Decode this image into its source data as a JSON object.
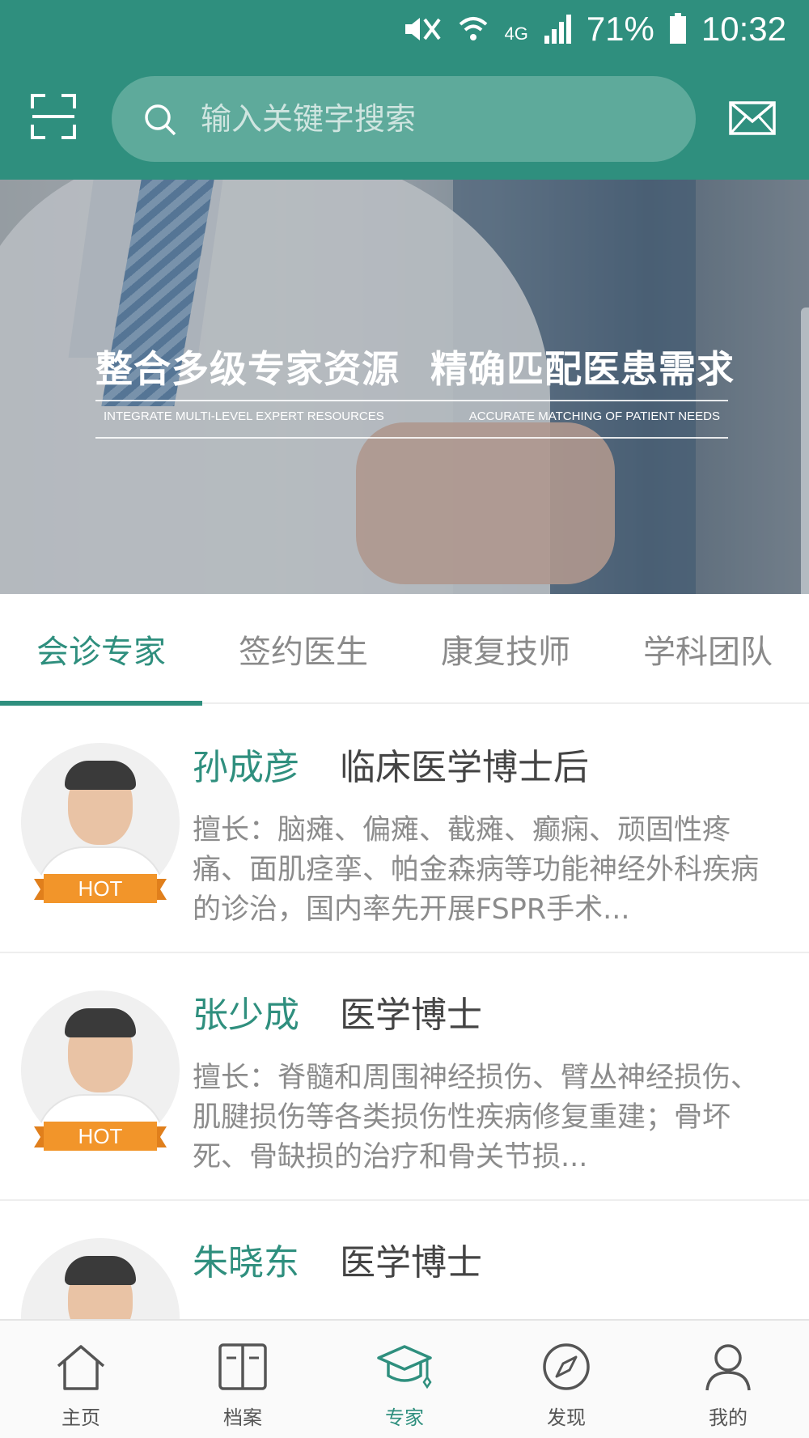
{
  "status_bar": {
    "network": "4G",
    "battery": "71%",
    "time": "10:32"
  },
  "search": {
    "placeholder": "输入关键字搜索"
  },
  "banner": {
    "title_left": "整合多级专家资源",
    "title_right": "精确匹配医患需求",
    "sub_left": "INTEGRATE MULTI-LEVEL EXPERT RESOURCES",
    "sub_right": "ACCURATE MATCHING OF PATIENT NEEDS"
  },
  "tabs": [
    {
      "label": "会诊专家",
      "active": true
    },
    {
      "label": "签约医生",
      "active": false
    },
    {
      "label": "康复技师",
      "active": false
    },
    {
      "label": "学科团队",
      "active": false
    }
  ],
  "doctors": [
    {
      "name": "孙成彦",
      "title": "临床医学博士后",
      "badge": "HOT",
      "desc": "擅长：脑瘫、偏瘫、截瘫、癫痫、顽固性疼痛、面肌痉挛、帕金森病等功能神经外科疾病的诊治，国内率先开展FSPR手术..."
    },
    {
      "name": "张少成",
      "title": "医学博士",
      "badge": "HOT",
      "desc": "擅长：脊髓和周围神经损伤、臂丛神经损伤、肌腱损伤等各类损伤性疾病修复重建；骨坏死、骨缺损的治疗和骨关节损..."
    },
    {
      "name": "朱晓东",
      "title": "医学博士",
      "badge": "",
      "desc": ""
    }
  ],
  "bottom_nav": [
    {
      "label": "主页",
      "icon": "home-icon"
    },
    {
      "label": "档案",
      "icon": "archive-icon"
    },
    {
      "label": "专家",
      "icon": "graduation-cap-icon",
      "active": true
    },
    {
      "label": "发现",
      "icon": "compass-icon"
    },
    {
      "label": "我的",
      "icon": "user-icon"
    }
  ],
  "colors": {
    "primary": "#2f8f7e",
    "hot_badge": "#f2952a",
    "text_gray": "#8c8c8c"
  }
}
